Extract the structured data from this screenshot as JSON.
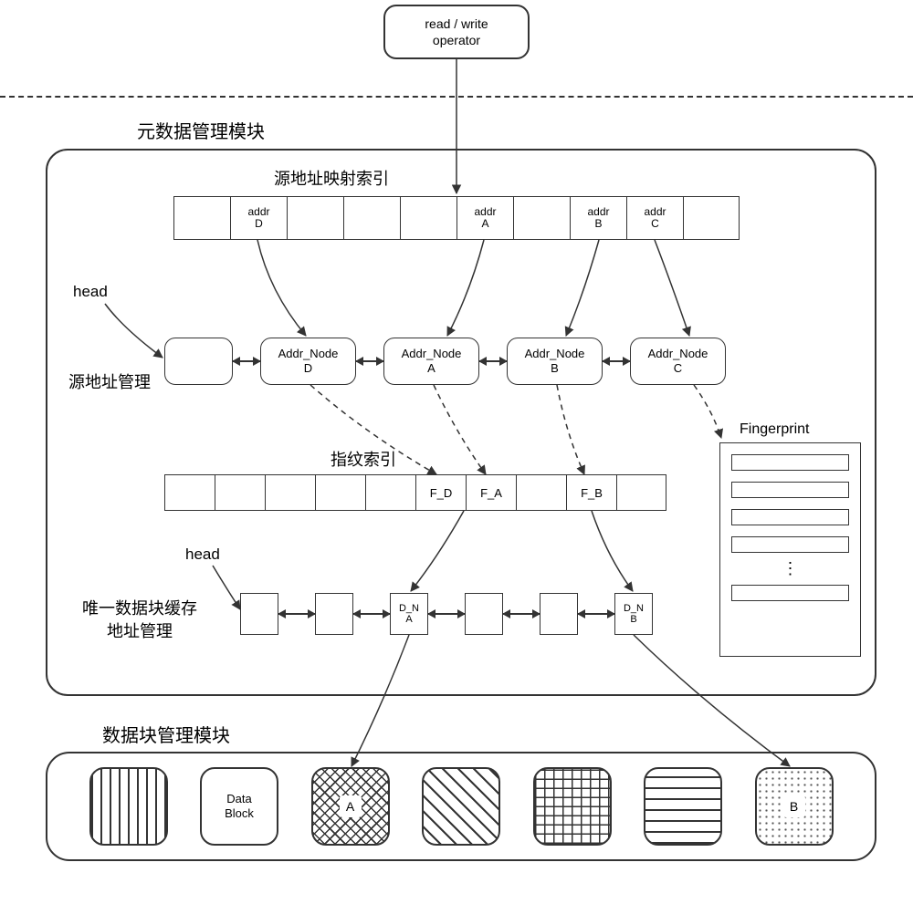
{
  "top_box": {
    "line1": "read / write",
    "line2": "operator"
  },
  "meta_module_label": "元数据管理模块",
  "src_index_label": "源地址映射索引",
  "src_cells": [
    "",
    "addr\nD",
    "",
    "",
    "",
    "addr\nA",
    "",
    "addr\nB",
    "addr\nC",
    ""
  ],
  "head_label": "head",
  "src_addr_mgr_label": "源地址管理",
  "addr_nodes": [
    "",
    "Addr_Node\nD",
    "Addr_Node\nA",
    "Addr_Node\nB",
    "Addr_Node\nC"
  ],
  "fp_index_label": "指纹索引",
  "fp_cells": [
    "",
    "",
    "",
    "",
    "",
    "F_D",
    "F_A",
    "",
    "F_B",
    ""
  ],
  "fingerprint_label": "Fingerprint",
  "uniq_label": "唯一数据块缓存\n地址管理",
  "uniq_nodes": [
    "",
    "",
    "D_N\nA",
    "",
    "",
    "D_N\nB"
  ],
  "data_module_label": "数据块管理模块",
  "data_block_label": "Data\nBlock",
  "block_a": "A",
  "block_b": "B"
}
